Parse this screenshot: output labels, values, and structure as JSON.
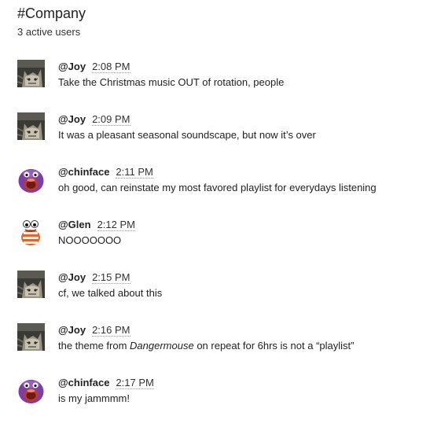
{
  "channel": {
    "title": "#Company",
    "active_users": "3 active users"
  },
  "messages": [
    {
      "user": "@Joy",
      "avatar": "cat-avatar-icon",
      "time": "2:08 PM",
      "text": "Take the Christmas music OUT of rotation, people"
    },
    {
      "user": "@Joy",
      "avatar": "cat-avatar-icon",
      "time": "2:09 PM",
      "text": "It was a pleasant seasonal soundscape, but now it’s over"
    },
    {
      "user": "@chinface",
      "avatar": "purple-creature-avatar-icon",
      "time": "2:11 PM",
      "text": "oh good, can reinstate my most favored playlist for everydays listening"
    },
    {
      "user": "@Glen",
      "avatar": "orange-character-avatar-icon",
      "time": "2:12 PM",
      "text": "NOOOOOOO"
    },
    {
      "user": "@Joy",
      "avatar": "cat-avatar-icon",
      "time": "2:15 PM",
      "text": "cf, we talked about this"
    },
    {
      "user": "@Joy",
      "avatar": "cat-avatar-icon",
      "time": "2:16 PM",
      "text_before": "the theme from ",
      "text_italic": "Dangermouse",
      "text_after": " on repeat for 6hrs is not a “playlist”"
    },
    {
      "user": "@chinface",
      "avatar": "purple-creature-avatar-icon",
      "time": "2:17 PM",
      "text": "is my jammmm!"
    }
  ]
}
